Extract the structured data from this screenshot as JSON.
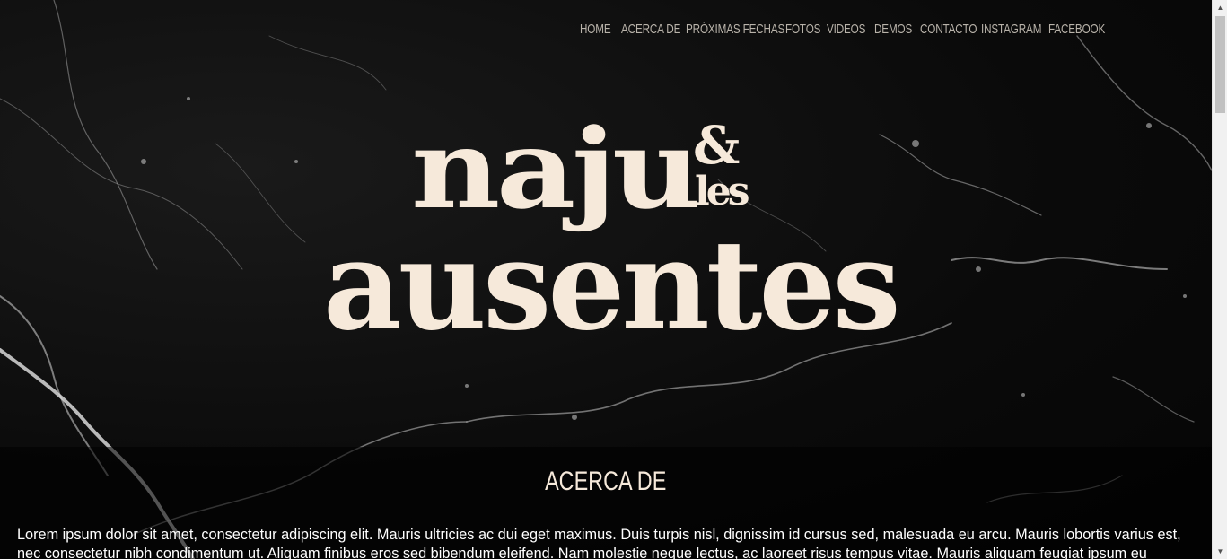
{
  "nav": {
    "items": [
      {
        "label": "HOME"
      },
      {
        "label": "ACERCA DE"
      },
      {
        "label": "PRÓXIMAS FECHAS"
      },
      {
        "label": "FOTOS"
      },
      {
        "label": "VIDEOS"
      },
      {
        "label": "DEMOS"
      },
      {
        "label": "CONTACTO"
      },
      {
        "label": "INSTAGRAM"
      },
      {
        "label": "FACEBOOK"
      }
    ]
  },
  "logo": {
    "line1": "naju",
    "ampersand": "&",
    "les": "les",
    "line2": "ausentes"
  },
  "about": {
    "title": "ACERCA DE",
    "body": "Lorem ipsum dolor sit amet, consectetur adipiscing elit. Mauris ultricies ac dui eget maximus. Duis turpis nisl, dignissim id cursus sed, malesuada eu arcu. Mauris lobortis varius est, nec consectetur nibh condimentum ut. Aliquam finibus eros sed bibendum eleifend. Nam molestie neque lectus, ac laoreet risus tempus vitae. Mauris aliquam feugiat ipsum eu faucibus."
  },
  "colors": {
    "background": "#0b0b0b",
    "logo": "#f6e9da",
    "nav_text": "#b9b3aa"
  },
  "scrollbar": {
    "up_icon": "scroll-up-arrow-icon",
    "down_icon": "scroll-down-arrow-icon"
  }
}
